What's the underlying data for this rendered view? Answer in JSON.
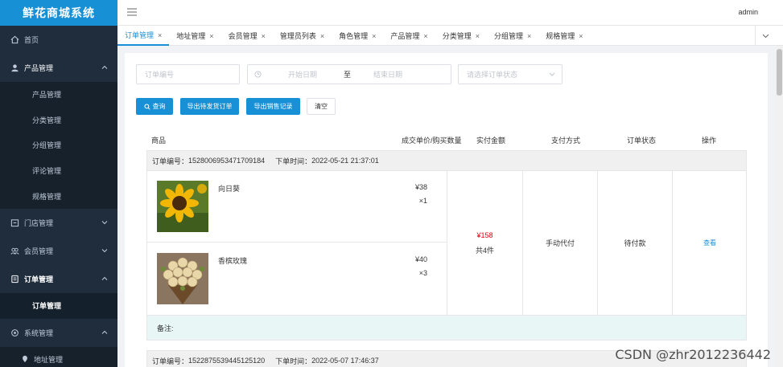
{
  "app": {
    "title": "鲜花商城系统",
    "user": "admin"
  },
  "sidebar": {
    "items": [
      {
        "label": "首页",
        "icon": "home-icon"
      },
      {
        "label": "产品管理",
        "icon": "user-icon",
        "expanded": true,
        "children": [
          "产品管理",
          "分类管理",
          "分组管理",
          "评论管理",
          "规格管理"
        ]
      },
      {
        "label": "门店管理",
        "icon": "store-icon"
      },
      {
        "label": "会员管理",
        "icon": "members-icon"
      },
      {
        "label": "订单管理",
        "icon": "order-icon",
        "expanded": true,
        "children": [
          "订单管理"
        ]
      },
      {
        "label": "系统管理",
        "icon": "settings-icon",
        "expanded": true,
        "children": [
          "地址管理"
        ]
      }
    ]
  },
  "tabs": [
    "订单管理",
    "地址管理",
    "会员管理",
    "管理员列表",
    "角色管理",
    "产品管理",
    "分类管理",
    "分组管理",
    "规格管理"
  ],
  "filters": {
    "order_no_placeholder": "订单编号",
    "start_date_placeholder": "开始日期",
    "range_sep": "至",
    "end_date_placeholder": "结束日期",
    "status_placeholder": "请选择订单状态"
  },
  "buttons": {
    "search": "查询",
    "export_pending": "导出待发货订单",
    "export_sales": "导出销售记录",
    "clear": "清空"
  },
  "table_headers": {
    "product": "商品",
    "price_qty": "成交单价/购买数量",
    "amount": "实付金额",
    "payment": "支付方式",
    "status": "订单状态",
    "action": "操作"
  },
  "orders": [
    {
      "order_no_label": "订单编号：",
      "order_no": "1528006953471709184",
      "time_label": "下单时间：",
      "time": "2022-05-21 21:37:01",
      "products": [
        {
          "name": "向日葵",
          "price": "¥38",
          "qty": "×1"
        },
        {
          "name": "香槟玫瑰",
          "price": "¥40",
          "qty": "×3"
        }
      ],
      "amount": "¥158",
      "count": "共4件",
      "payment": "手动代付",
      "status": "待付款",
      "action": "查看",
      "remark_label": "备注:"
    },
    {
      "order_no_label": "订单编号：",
      "order_no": "1522875539445125120",
      "time_label": "下单时间：",
      "time": "2022-05-07 17:46:37"
    }
  ],
  "watermark": "CSDN @zhr2012236442",
  "colors": {
    "primary": "#1890d6",
    "sidebar": "#1f2d3d",
    "price": "#e60012"
  }
}
